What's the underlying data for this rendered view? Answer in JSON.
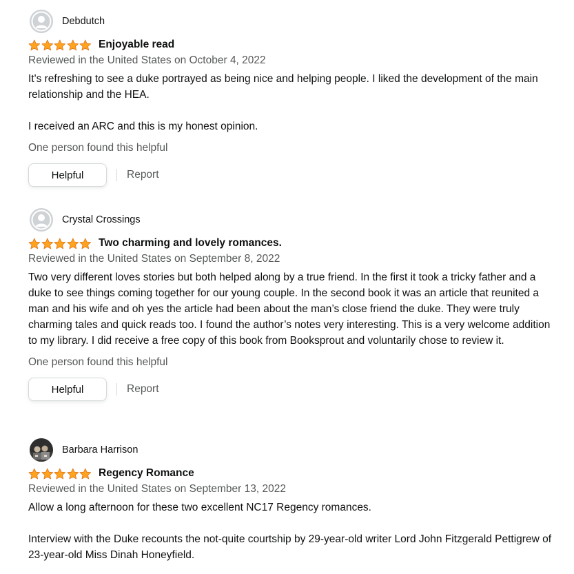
{
  "colors": {
    "star": "#ffa41c",
    "star_outline": "#de7921",
    "text": "#0f1111",
    "secondary_text": "#565959",
    "avatar_bg": "#cfd3d6",
    "button_border": "#d5d9d9"
  },
  "reviews": [
    {
      "reviewer": "Debdutch",
      "avatar": "default-avatar-icon",
      "rating": 5,
      "title": "Enjoyable read",
      "date": "Reviewed in the United States on October 4, 2022",
      "body": [
        "It's refreshing to see a duke portrayed as being nice and helping people. I liked the development of the main relationship and the HEA.",
        "I received an ARC and this is my honest opinion."
      ],
      "helpful_count": "One person found this helpful",
      "helpful_label": "Helpful",
      "report_label": "Report"
    },
    {
      "reviewer": "Crystal Crossings",
      "avatar": "default-avatar-icon",
      "rating": 5,
      "title": "Two charming and lovely romances.",
      "date": "Reviewed in the United States on September 8, 2022",
      "body": [
        "Two very different loves stories but both helped along by a true friend. In the first it took a tricky father and a duke to see things coming together for our young couple. In the second book it was an article that reunited a man and his wife and oh yes the article had been about the man’s close friend the duke. They were truly charming tales and quick reads too. I found the author’s notes very interesting. This is a very welcome addition to my library. I did receive a free copy of this book from Booksprout and voluntarily chose to review it."
      ],
      "helpful_count": "One person found this helpful",
      "helpful_label": "Helpful",
      "report_label": "Report"
    },
    {
      "reviewer": "Barbara Harrison",
      "avatar": "photo-avatar",
      "rating": 5,
      "title": "Regency Romance",
      "date": "Reviewed in the United States on September 13, 2022",
      "body": [
        "Allow a long afternoon for these two excellent NC17 Regency romances.",
        "Interview with the Duke recounts the not-quite courtship by 29-year-old writer Lord John Fitzgerald Pettigrew of 23-year-old Miss Dinah Honeyfield."
      ]
    }
  ]
}
